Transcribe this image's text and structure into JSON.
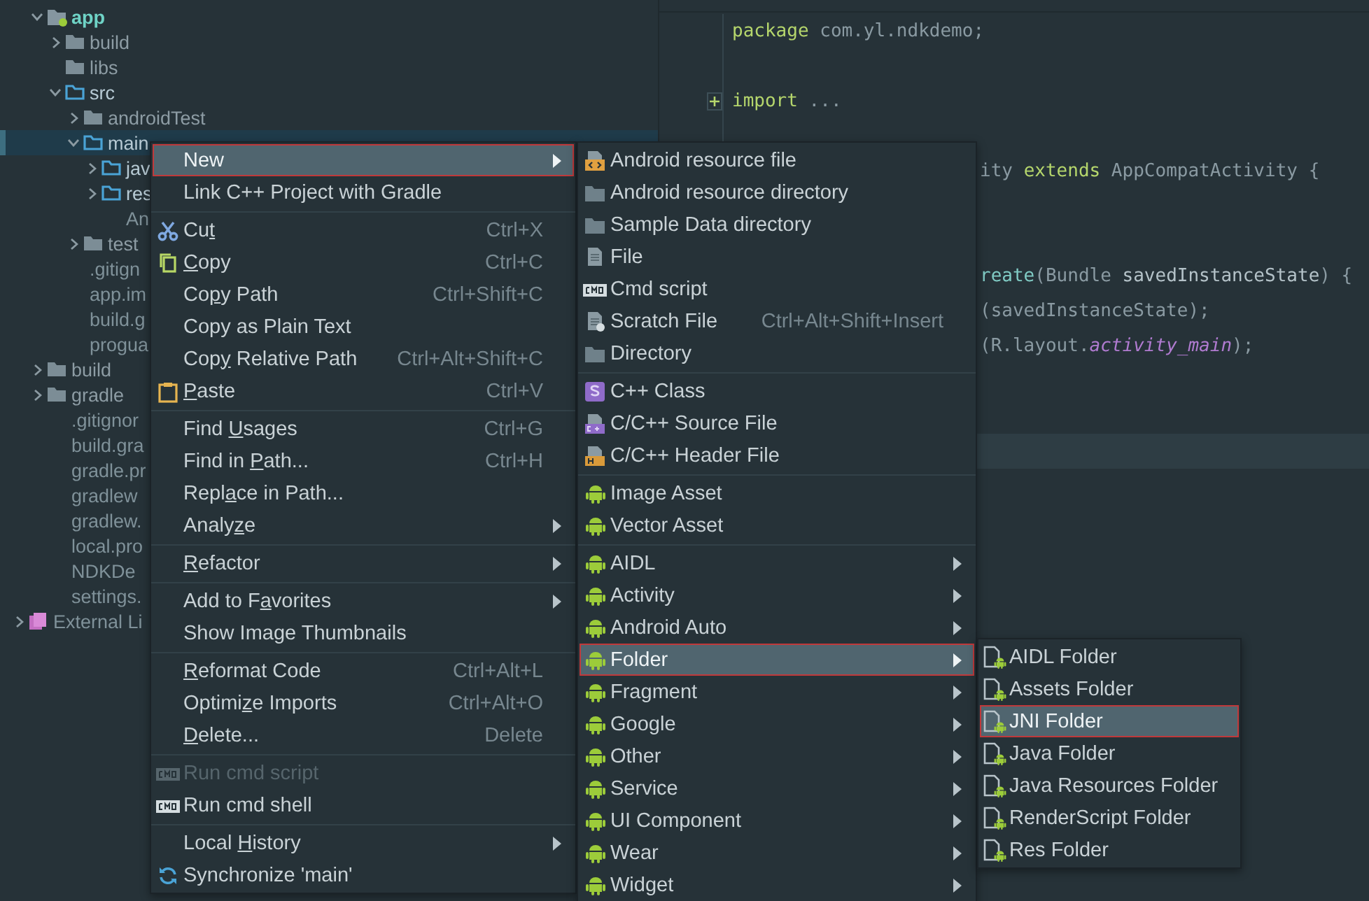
{
  "tree": [
    {
      "label": "app",
      "kind": "module",
      "expanded": true,
      "selected": false,
      "children": [
        {
          "label": "build",
          "kind": "folder",
          "expanded": false,
          "selected": false
        },
        {
          "label": "libs",
          "kind": "folder",
          "selected": false
        },
        {
          "label": "src",
          "kind": "source-folder",
          "expanded": true,
          "selected": false,
          "children": [
            {
              "label": "androidTest",
              "kind": "folder",
              "expanded": false,
              "selected": false
            },
            {
              "label": "main",
              "kind": "source-folder",
              "expanded": true,
              "selected": true,
              "children": [
                {
                  "label": "jav",
                  "kind": "source-folder",
                  "expanded": false,
                  "selected": false
                },
                {
                  "label": "res",
                  "kind": "source-folder",
                  "expanded": false,
                  "selected": false
                },
                {
                  "label": "An",
                  "kind": "file",
                  "selected": false
                }
              ]
            },
            {
              "label": "test",
              "kind": "folder",
              "expanded": false,
              "selected": false
            }
          ]
        },
        {
          "label": ".gitign",
          "kind": "file",
          "selected": false
        },
        {
          "label": "app.im",
          "kind": "file",
          "selected": false
        },
        {
          "label": "build.g",
          "kind": "file",
          "selected": false
        },
        {
          "label": "progua",
          "kind": "file",
          "selected": false
        }
      ]
    },
    {
      "label": "build",
      "kind": "folder",
      "expanded": false,
      "selected": false
    },
    {
      "label": "gradle",
      "kind": "folder",
      "expanded": false,
      "selected": false
    },
    {
      "label": ".gitignor",
      "kind": "file",
      "selected": false
    },
    {
      "label": "build.gra",
      "kind": "file",
      "selected": false
    },
    {
      "label": "gradle.pr",
      "kind": "file",
      "selected": false
    },
    {
      "label": "gradlew",
      "kind": "file",
      "selected": false
    },
    {
      "label": "gradlew.",
      "kind": "file",
      "selected": false
    },
    {
      "label": "local.pro",
      "kind": "file",
      "selected": false
    },
    {
      "label": "NDKDe",
      "kind": "file",
      "selected": false
    },
    {
      "label": "settings.",
      "kind": "file",
      "selected": false
    }
  ],
  "external_libraries": {
    "label": "External Li",
    "expanded": false,
    "selected": false
  },
  "code_lines": [
    {
      "kind": "full",
      "tokens": [
        {
          "kind": "keyword",
          "text": "package"
        },
        {
          "kind": "plain",
          "text": " com.yl.ndkdemo;"
        }
      ]
    },
    {
      "kind": "blank"
    },
    {
      "kind": "folded",
      "tokens": [
        {
          "kind": "keyword",
          "text": "import"
        },
        {
          "kind": "plain",
          "text": " ..."
        }
      ]
    },
    {
      "kind": "blank"
    },
    {
      "kind": "clipped",
      "tokens": [
        {
          "kind": "plain",
          "text": "ity "
        },
        {
          "kind": "keyword",
          "text": "extends"
        },
        {
          "kind": "plain",
          "text": " AppCompatActivity {"
        }
      ]
    },
    {
      "kind": "blank"
    },
    {
      "kind": "blank"
    },
    {
      "kind": "clipped",
      "tokens": [
        {
          "kind": "method",
          "text": "reate"
        },
        {
          "kind": "plain",
          "text": "(Bundle "
        },
        {
          "kind": "ident",
          "text": "savedInstanceState"
        },
        {
          "kind": "plain",
          "text": ") {"
        }
      ]
    },
    {
      "kind": "clipped",
      "tokens": [
        {
          "kind": "plain",
          "text": "(savedInstanceState);"
        }
      ]
    },
    {
      "kind": "clipped",
      "tokens": [
        {
          "kind": "plain",
          "text": "(R.layout."
        },
        {
          "kind": "field",
          "text": "activity_main"
        },
        {
          "kind": "plain",
          "text": ");"
        }
      ]
    },
    {
      "kind": "blank"
    },
    {
      "kind": "blank"
    },
    {
      "kind": "current"
    }
  ],
  "menus": [
    {
      "items": [
        {
          "kind": "item",
          "label": "New",
          "submenu": true,
          "selected": true,
          "disabled": false
        },
        {
          "kind": "item",
          "label": "Link C++ Project with Gradle",
          "submenu": false,
          "selected": false,
          "disabled": false
        },
        {
          "kind": "separator"
        },
        {
          "kind": "item",
          "label": [
            {
              "text": "Cu",
              "mnemonic": false
            },
            {
              "text": "t",
              "mnemonic": true
            }
          ],
          "shortcut": "Ctrl+X",
          "submenu": false,
          "selected": false,
          "disabled": false
        },
        {
          "kind": "item",
          "label": [
            {
              "text": "C",
              "mnemonic": true
            },
            {
              "text": "opy",
              "mnemonic": false
            }
          ],
          "shortcut": "Ctrl+C",
          "submenu": false,
          "selected": false,
          "disabled": false
        },
        {
          "kind": "item",
          "label": [
            {
              "text": "Co",
              "mnemonic": false
            },
            {
              "text": "p",
              "mnemonic": true
            },
            {
              "text": "y Path",
              "mnemonic": false
            }
          ],
          "shortcut": "Ctrl+Shift+C",
          "submenu": false,
          "selected": false,
          "disabled": false
        },
        {
          "kind": "item",
          "label": "Copy as Plain Text",
          "submenu": false,
          "selected": false,
          "disabled": false
        },
        {
          "kind": "item",
          "label": [
            {
              "text": "Cop",
              "mnemonic": false
            },
            {
              "text": "y",
              "mnemonic": true
            },
            {
              "text": " Relative Path",
              "mnemonic": false
            }
          ],
          "shortcut": "Ctrl+Alt+Shift+C",
          "submenu": false,
          "selected": false,
          "disabled": false
        },
        {
          "kind": "item",
          "label": [
            {
              "text": "P",
              "mnemonic": true
            },
            {
              "text": "aste",
              "mnemonic": false
            }
          ],
          "shortcut": "Ctrl+V",
          "submenu": false,
          "selected": false,
          "disabled": false
        },
        {
          "kind": "separator"
        },
        {
          "kind": "item",
          "label": [
            {
              "text": "Find ",
              "mnemonic": false
            },
            {
              "text": "U",
              "mnemonic": true
            },
            {
              "text": "sages",
              "mnemonic": false
            }
          ],
          "shortcut": "Ctrl+G",
          "submenu": false,
          "selected": false,
          "disabled": false
        },
        {
          "kind": "item",
          "label": [
            {
              "text": "Find in ",
              "mnemonic": false
            },
            {
              "text": "P",
              "mnemonic": true
            },
            {
              "text": "ath...",
              "mnemonic": false
            }
          ],
          "shortcut": "Ctrl+H",
          "submenu": false,
          "selected": false,
          "disabled": false
        },
        {
          "kind": "item",
          "label": [
            {
              "text": "Repl",
              "mnemonic": false
            },
            {
              "text": "a",
              "mnemonic": true
            },
            {
              "text": "ce in Path...",
              "mnemonic": false
            }
          ],
          "submenu": false,
          "selected": false,
          "disabled": false
        },
        {
          "kind": "item",
          "label": [
            {
              "text": "Analy",
              "mnemonic": false
            },
            {
              "text": "z",
              "mnemonic": true
            },
            {
              "text": "e",
              "mnemonic": false
            }
          ],
          "submenu": true,
          "selected": false,
          "disabled": false
        },
        {
          "kind": "separator"
        },
        {
          "kind": "item",
          "label": [
            {
              "text": "R",
              "mnemonic": true
            },
            {
              "text": "efactor",
              "mnemonic": false
            }
          ],
          "submenu": true,
          "selected": false,
          "disabled": false
        },
        {
          "kind": "separator"
        },
        {
          "kind": "item",
          "label": [
            {
              "text": "Add to F",
              "mnemonic": false
            },
            {
              "text": "a",
              "mnemonic": true
            },
            {
              "text": "vorites",
              "mnemonic": false
            }
          ],
          "submenu": true,
          "selected": false,
          "disabled": false
        },
        {
          "kind": "item",
          "label": "Show Image Thumbnails",
          "submenu": false,
          "selected": false,
          "disabled": false
        },
        {
          "kind": "separator"
        },
        {
          "kind": "item",
          "label": [
            {
              "text": "R",
              "mnemonic": true
            },
            {
              "text": "eformat Code",
              "mnemonic": false
            }
          ],
          "shortcut": "Ctrl+Alt+L",
          "submenu": false,
          "selected": false,
          "disabled": false
        },
        {
          "kind": "item",
          "label": [
            {
              "text": "Optimi",
              "mnemonic": false
            },
            {
              "text": "z",
              "mnemonic": true
            },
            {
              "text": "e Imports",
              "mnemonic": false
            }
          ],
          "shortcut": "Ctrl+Alt+O",
          "submenu": false,
          "selected": false,
          "disabled": false
        },
        {
          "kind": "item",
          "label": [
            {
              "text": "D",
              "mnemonic": true
            },
            {
              "text": "elete...",
              "mnemonic": false
            }
          ],
          "shortcut": "Delete",
          "submenu": false,
          "selected": false,
          "disabled": false
        },
        {
          "kind": "separator"
        },
        {
          "kind": "item",
          "label": "Run cmd script",
          "submenu": false,
          "selected": false,
          "disabled": true
        },
        {
          "kind": "item",
          "label": "Run cmd shell",
          "submenu": false,
          "selected": false,
          "disabled": false
        },
        {
          "kind": "separator"
        },
        {
          "kind": "item",
          "label": [
            {
              "text": "Local ",
              "mnemonic": false
            },
            {
              "text": "H",
              "mnemonic": true
            },
            {
              "text": "istory",
              "mnemonic": false
            }
          ],
          "submenu": true,
          "selected": false,
          "disabled": false
        },
        {
          "kind": "item",
          "label": "Synchronize 'main'",
          "submenu": false,
          "selected": false,
          "disabled": false
        }
      ]
    },
    {
      "items": [
        {
          "kind": "item",
          "label": "Android resource file",
          "submenu": false,
          "selected": false,
          "disabled": false
        },
        {
          "kind": "item",
          "label": "Android resource directory",
          "submenu": false,
          "selected": false,
          "disabled": false
        },
        {
          "kind": "item",
          "label": "Sample Data directory",
          "submenu": false,
          "selected": false,
          "disabled": false
        },
        {
          "kind": "item",
          "label": "File",
          "submenu": false,
          "selected": false,
          "disabled": false
        },
        {
          "kind": "item",
          "label": "Cmd script",
          "submenu": false,
          "selected": false,
          "disabled": false
        },
        {
          "kind": "item",
          "label": "Scratch File",
          "shortcut": "Ctrl+Alt+Shift+Insert",
          "submenu": false,
          "selected": false,
          "disabled": false
        },
        {
          "kind": "item",
          "label": "Directory",
          "submenu": false,
          "selected": false,
          "disabled": false
        },
        {
          "kind": "separator"
        },
        {
          "kind": "item",
          "label": "C++ Class",
          "submenu": false,
          "selected": false,
          "disabled": false
        },
        {
          "kind": "item",
          "label": "C/C++ Source File",
          "submenu": false,
          "selected": false,
          "disabled": false
        },
        {
          "kind": "item",
          "label": "C/C++ Header File",
          "submenu": false,
          "selected": false,
          "disabled": false
        },
        {
          "kind": "separator"
        },
        {
          "kind": "item",
          "label": "Image Asset",
          "submenu": false,
          "selected": false,
          "disabled": false
        },
        {
          "kind": "item",
          "label": "Vector Asset",
          "submenu": false,
          "selected": false,
          "disabled": false
        },
        {
          "kind": "separator"
        },
        {
          "kind": "item",
          "label": "AIDL",
          "submenu": true,
          "selected": false,
          "disabled": false
        },
        {
          "kind": "item",
          "label": "Activity",
          "submenu": true,
          "selected": false,
          "disabled": false
        },
        {
          "kind": "item",
          "label": "Android Auto",
          "submenu": true,
          "selected": false,
          "disabled": false
        },
        {
          "kind": "item",
          "label": "Folder",
          "submenu": true,
          "selected": true,
          "disabled": false
        },
        {
          "kind": "item",
          "label": "Fragment",
          "submenu": true,
          "selected": false,
          "disabled": false
        },
        {
          "kind": "item",
          "label": "Google",
          "submenu": true,
          "selected": false,
          "disabled": false
        },
        {
          "kind": "item",
          "label": "Other",
          "submenu": true,
          "selected": false,
          "disabled": false
        },
        {
          "kind": "item",
          "label": "Service",
          "submenu": true,
          "selected": false,
          "disabled": false
        },
        {
          "kind": "item",
          "label": "UI Component",
          "submenu": true,
          "selected": false,
          "disabled": false
        },
        {
          "kind": "item",
          "label": "Wear",
          "submenu": true,
          "selected": false,
          "disabled": false
        },
        {
          "kind": "item",
          "label": "Widget",
          "submenu": true,
          "selected": false,
          "disabled": false
        }
      ]
    },
    {
      "items": [
        {
          "kind": "item",
          "label": "AIDL Folder",
          "submenu": false,
          "selected": false,
          "disabled": false
        },
        {
          "kind": "item",
          "label": "Assets Folder",
          "submenu": false,
          "selected": false,
          "disabled": false
        },
        {
          "kind": "item",
          "label": "JNI Folder",
          "submenu": false,
          "selected": true,
          "disabled": false
        },
        {
          "kind": "item",
          "label": "Java Folder",
          "submenu": false,
          "selected": false,
          "disabled": false
        },
        {
          "kind": "item",
          "label": "Java Resources Folder",
          "submenu": false,
          "selected": false,
          "disabled": false
        },
        {
          "kind": "item",
          "label": "RenderScript Folder",
          "submenu": false,
          "selected": false,
          "disabled": false
        },
        {
          "kind": "item",
          "label": "Res Folder",
          "submenu": false,
          "selected": false,
          "disabled": false
        }
      ]
    }
  ]
}
